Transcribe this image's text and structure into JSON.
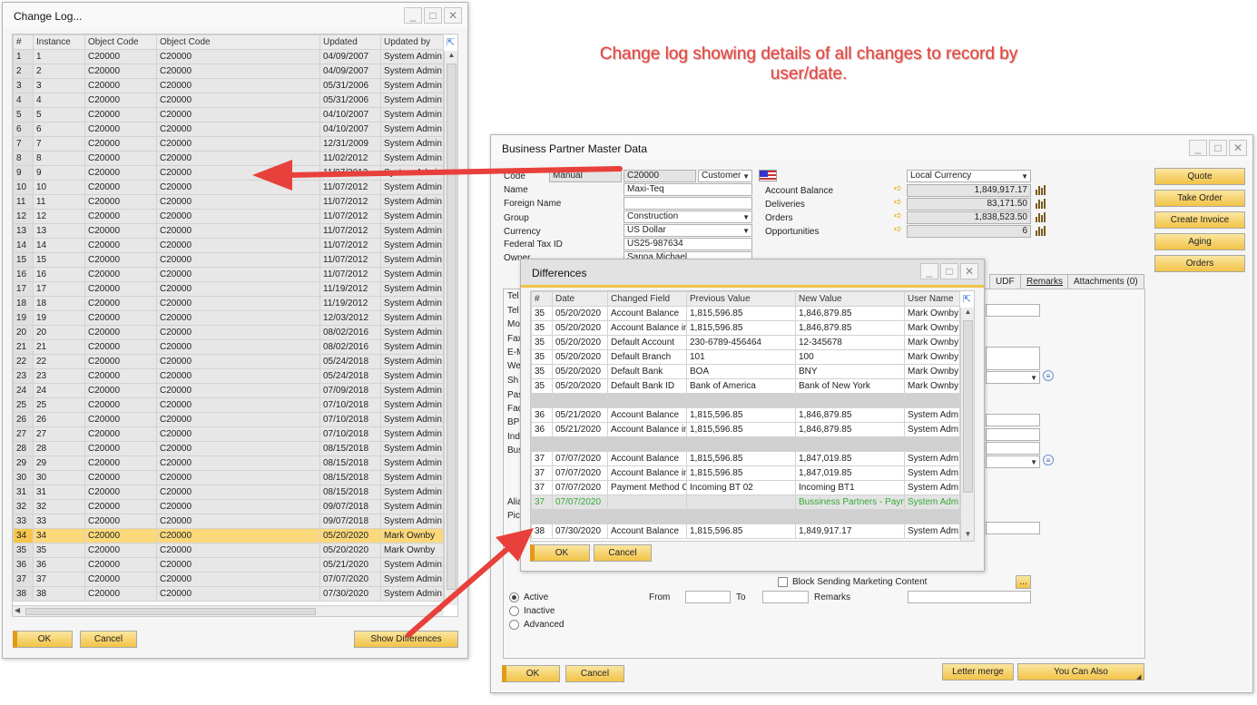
{
  "change_log": {
    "title": "Change Log...",
    "columns": [
      "#",
      "Instance",
      "Object Code",
      "Object Code",
      "Updated",
      "Updated by"
    ],
    "rows": [
      [
        "1",
        "1",
        "C20000",
        "C20000",
        "04/09/2007",
        "System Admin"
      ],
      [
        "2",
        "2",
        "C20000",
        "C20000",
        "04/09/2007",
        "System Admin"
      ],
      [
        "3",
        "3",
        "C20000",
        "C20000",
        "05/31/2006",
        "System Admin"
      ],
      [
        "4",
        "4",
        "C20000",
        "C20000",
        "05/31/2006",
        "System Admin"
      ],
      [
        "5",
        "5",
        "C20000",
        "C20000",
        "04/10/2007",
        "System Admin"
      ],
      [
        "6",
        "6",
        "C20000",
        "C20000",
        "04/10/2007",
        "System Admin"
      ],
      [
        "7",
        "7",
        "C20000",
        "C20000",
        "12/31/2009",
        "System Admin"
      ],
      [
        "8",
        "8",
        "C20000",
        "C20000",
        "11/02/2012",
        "System Admin"
      ],
      [
        "9",
        "9",
        "C20000",
        "C20000",
        "11/07/2012",
        "System Admin"
      ],
      [
        "10",
        "10",
        "C20000",
        "C20000",
        "11/07/2012",
        "System Admin"
      ],
      [
        "11",
        "11",
        "C20000",
        "C20000",
        "11/07/2012",
        "System Admin"
      ],
      [
        "12",
        "12",
        "C20000",
        "C20000",
        "11/07/2012",
        "System Admin"
      ],
      [
        "13",
        "13",
        "C20000",
        "C20000",
        "11/07/2012",
        "System Admin"
      ],
      [
        "14",
        "14",
        "C20000",
        "C20000",
        "11/07/2012",
        "System Admin"
      ],
      [
        "15",
        "15",
        "C20000",
        "C20000",
        "11/07/2012",
        "System Admin"
      ],
      [
        "16",
        "16",
        "C20000",
        "C20000",
        "11/07/2012",
        "System Admin"
      ],
      [
        "17",
        "17",
        "C20000",
        "C20000",
        "11/19/2012",
        "System Admin"
      ],
      [
        "18",
        "18",
        "C20000",
        "C20000",
        "11/19/2012",
        "System Admin"
      ],
      [
        "19",
        "19",
        "C20000",
        "C20000",
        "12/03/2012",
        "System Admin"
      ],
      [
        "20",
        "20",
        "C20000",
        "C20000",
        "08/02/2016",
        "System Admin"
      ],
      [
        "21",
        "21",
        "C20000",
        "C20000",
        "08/02/2016",
        "System Admin"
      ],
      [
        "22",
        "22",
        "C20000",
        "C20000",
        "05/24/2018",
        "System Admin"
      ],
      [
        "23",
        "23",
        "C20000",
        "C20000",
        "05/24/2018",
        "System Admin"
      ],
      [
        "24",
        "24",
        "C20000",
        "C20000",
        "07/09/2018",
        "System Admin"
      ],
      [
        "25",
        "25",
        "C20000",
        "C20000",
        "07/10/2018",
        "System Admin"
      ],
      [
        "26",
        "26",
        "C20000",
        "C20000",
        "07/10/2018",
        "System Admin"
      ],
      [
        "27",
        "27",
        "C20000",
        "C20000",
        "07/10/2018",
        "System Admin"
      ],
      [
        "28",
        "28",
        "C20000",
        "C20000",
        "08/15/2018",
        "System Admin"
      ],
      [
        "29",
        "29",
        "C20000",
        "C20000",
        "08/15/2018",
        "System Admin"
      ],
      [
        "30",
        "30",
        "C20000",
        "C20000",
        "08/15/2018",
        "System Admin"
      ],
      [
        "31",
        "31",
        "C20000",
        "C20000",
        "08/15/2018",
        "System Admin"
      ],
      [
        "32",
        "32",
        "C20000",
        "C20000",
        "09/07/2018",
        "System Admin"
      ],
      [
        "33",
        "33",
        "C20000",
        "C20000",
        "09/07/2018",
        "System Admin"
      ],
      [
        "34",
        "34",
        "C20000",
        "C20000",
        "05/20/2020",
        "Mark Ownby"
      ],
      [
        "35",
        "35",
        "C20000",
        "C20000",
        "05/20/2020",
        "Mark Ownby"
      ],
      [
        "36",
        "36",
        "C20000",
        "C20000",
        "05/21/2020",
        "System Admin"
      ],
      [
        "37",
        "37",
        "C20000",
        "C20000",
        "07/07/2020",
        "System Admin"
      ],
      [
        "38",
        "38",
        "C20000",
        "C20000",
        "07/30/2020",
        "System Admin"
      ]
    ],
    "selected_row": "34",
    "ok": "OK",
    "cancel": "Cancel",
    "show_differences": "Show Differences"
  },
  "annotation": "Change log showing details of all changes to record by user/date.",
  "bp": {
    "title": "Business Partner Master Data",
    "code_label": "Code",
    "code_mode": "Manual",
    "code_value": "C20000",
    "type_value": "Customer",
    "name_label": "Name",
    "name_value": "Maxi-Teq",
    "foreign_name_label": "Foreign Name",
    "foreign_name_value": "",
    "group_label": "Group",
    "group_value": "Construction",
    "currency_label": "Currency",
    "currency_value": "US Dollar",
    "fed_tax_label": "Federal Tax ID",
    "fed_tax_value": "US25-987634",
    "owner_label": "Owner",
    "owner_value": "Sanna Michael",
    "local_currency": "Local Currency",
    "account_balance_label": "Account Balance",
    "account_balance": "1,849,917.17",
    "deliveries_label": "Deliveries",
    "deliveries": "83,171.50",
    "orders_label": "Orders",
    "orders": "1,838,523.50",
    "opportunities_label": "Opportunities",
    "opportunities": "6",
    "actions": [
      "Quote",
      "Take Order",
      "Create Invoice",
      "Aging",
      "Orders"
    ],
    "tabs": [
      "UDF",
      "Remarks",
      "Attachments (0)"
    ],
    "left_labels": [
      "Tel",
      "Tel",
      "Mo",
      "Fax",
      "E-M",
      "We",
      "Sh",
      "Pas",
      "Fac",
      "BP",
      "Ind",
      "Bus"
    ],
    "lower_labels": [
      "Alia",
      "Pic"
    ],
    "block_marketing": "Block Sending Marketing Content",
    "ellipsis": "...",
    "status_options": [
      "Active",
      "Inactive",
      "Advanced"
    ],
    "from_label": "From",
    "to_label": "To",
    "remarks_label": "Remarks",
    "ok": "OK",
    "cancel": "Cancel",
    "letter_merge": "Letter merge",
    "you_can_also": "You Can Also"
  },
  "differences": {
    "title": "Differences",
    "columns": [
      "#",
      "Date",
      "Changed Field",
      "Previous Value",
      "New Value",
      "User Name"
    ],
    "rows": [
      {
        "type": "row",
        "cells": [
          "35",
          "05/20/2020",
          "Account Balance",
          "1,815,596.85",
          "1,846,879.85",
          "Mark Ownby"
        ]
      },
      {
        "type": "row",
        "cells": [
          "35",
          "05/20/2020",
          "Account Balance in",
          "1,815,596.85",
          "1,846,879.85",
          "Mark Ownby"
        ]
      },
      {
        "type": "row",
        "cells": [
          "35",
          "05/20/2020",
          "Default Account",
          "230-6789-456464",
          "12-345678",
          "Mark Ownby"
        ]
      },
      {
        "type": "row",
        "cells": [
          "35",
          "05/20/2020",
          "Default Branch",
          "101",
          "100",
          "Mark Ownby"
        ]
      },
      {
        "type": "row",
        "cells": [
          "35",
          "05/20/2020",
          "Default Bank",
          "BOA",
          "BNY",
          "Mark Ownby"
        ]
      },
      {
        "type": "row",
        "cells": [
          "35",
          "05/20/2020",
          "Default Bank ID",
          "Bank of America",
          "Bank of New York",
          "Mark Ownby"
        ]
      },
      {
        "type": "gap",
        "cells": [
          "",
          "",
          "",
          "",
          "",
          ""
        ]
      },
      {
        "type": "row",
        "cells": [
          "36",
          "05/21/2020",
          "Account Balance",
          "1,815,596.85",
          "1,846,879.85",
          "System Adm"
        ]
      },
      {
        "type": "row",
        "cells": [
          "36",
          "05/21/2020",
          "Account Balance in",
          "1,815,596.85",
          "1,846,879.85",
          "System Adm"
        ]
      },
      {
        "type": "gap",
        "cells": [
          "",
          "",
          "",
          "",
          "",
          ""
        ]
      },
      {
        "type": "row",
        "cells": [
          "37",
          "07/07/2020",
          "Account Balance",
          "1,815,596.85",
          "1,847,019.85",
          "System Adm"
        ]
      },
      {
        "type": "row",
        "cells": [
          "37",
          "07/07/2020",
          "Account Balance in",
          "1,815,596.85",
          "1,847,019.85",
          "System Adm"
        ]
      },
      {
        "type": "row",
        "cells": [
          "37",
          "07/07/2020",
          "Payment Method C",
          "Incoming BT 02",
          "Incoming BT1",
          "System Adm"
        ]
      },
      {
        "type": "green",
        "cells": [
          "37",
          "07/07/2020",
          "",
          "",
          "Bussiness Partners - Payme",
          "System Adm"
        ]
      },
      {
        "type": "gap",
        "cells": [
          "",
          "",
          "",
          "",
          "",
          ""
        ]
      },
      {
        "type": "row",
        "cells": [
          "38",
          "07/30/2020",
          "Account Balance",
          "1,815,596.85",
          "1,849,917.17",
          "System Adm"
        ]
      }
    ],
    "ok": "OK",
    "cancel": "Cancel"
  },
  "colors": {
    "accent_orange": "#f2c347",
    "selected_row": "#fbd97b",
    "annotation_red": "#e8403a",
    "green_text": "#36a836"
  }
}
